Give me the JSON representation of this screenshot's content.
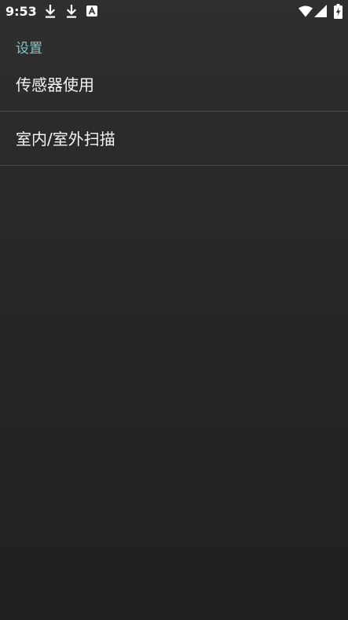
{
  "status_bar": {
    "time": "9:53",
    "icons": [
      "download-icon",
      "download-icon",
      "a-icon",
      "wifi-icon",
      "signal-icon",
      "battery-charging-icon"
    ]
  },
  "settings": {
    "section_title": "设置",
    "items": [
      {
        "label": "传感器使用"
      },
      {
        "label": "室内/室外扫描"
      }
    ]
  },
  "colors": {
    "accent": "#7fc6c0",
    "text": "#f3f3f3",
    "divider": "#4a4a4a",
    "background": "#2a2a2a"
  }
}
